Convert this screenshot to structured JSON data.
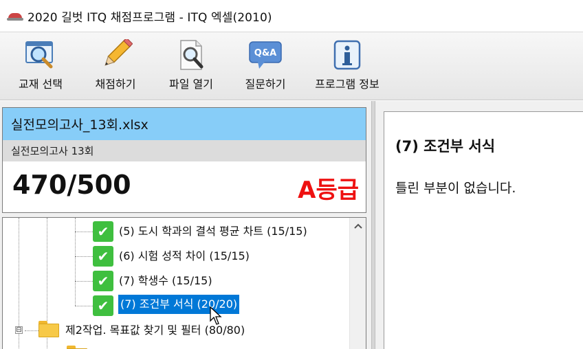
{
  "window": {
    "title": "2020 길벗 ITQ 채점프로그램 - ITQ 엑셀(2010)",
    "icon": "graduation-cap-icon"
  },
  "toolbar": {
    "items": [
      {
        "label": "교재 선택",
        "icon": "magnifier-window-icon"
      },
      {
        "label": "채점하기",
        "icon": "pencil-icon"
      },
      {
        "label": "파일 열기",
        "icon": "file-search-icon"
      },
      {
        "label": "질문하기",
        "icon": "qa-bubble-icon"
      },
      {
        "label": "프로그램 정보",
        "icon": "info-icon"
      }
    ]
  },
  "result": {
    "file_name": "실전모의고사_13회.xlsx",
    "exam_name": "실전모의고사 13회",
    "score": "470/500",
    "grade": "A등급",
    "grade_color": "#ee1111",
    "file_bar_color": "#87cdf8"
  },
  "tree": {
    "items": [
      {
        "label": "(5) 도시 학과의 결석 평균 차트 (15/15)",
        "status": "pass"
      },
      {
        "label": "(6) 시험 성적 차이 (15/15)",
        "status": "pass"
      },
      {
        "label": "(7) 학생수 (15/15)",
        "status": "pass"
      },
      {
        "label": "(7) 조건부 서식 (20/20)",
        "status": "pass",
        "selected": true
      }
    ],
    "folder": {
      "label": "제2작업. 목표값 찾기 및 필터 (80/80)",
      "expander": "⊟"
    }
  },
  "detail": {
    "title": "(7) 조건부 서식",
    "message": "틀린 부분이 없습니다."
  },
  "colors": {
    "check_green": "#3fbf3f",
    "selection_blue": "#0078d7"
  }
}
